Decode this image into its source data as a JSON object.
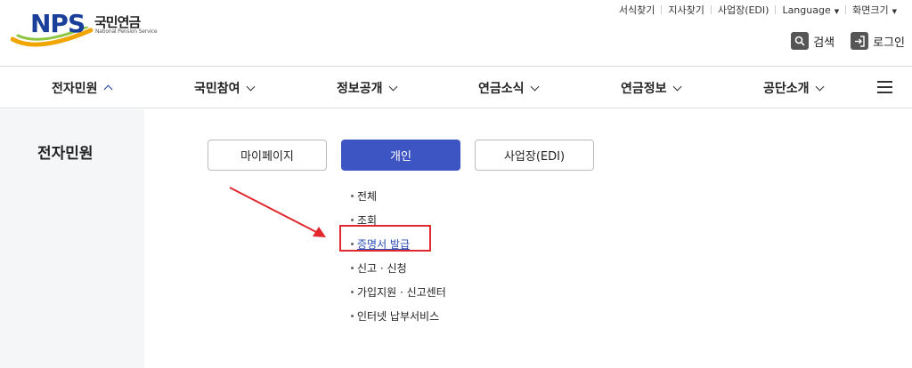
{
  "logo": {
    "nps": "NPS",
    "korean": "국민연금",
    "english": "National Pension Service"
  },
  "util_links": [
    "서식찾기",
    "지사찾기",
    "사업장(EDI)",
    "Language",
    "화면크기"
  ],
  "actions": {
    "search": "검색",
    "login": "로그인"
  },
  "gnb": [
    "전자민원",
    "국민참여",
    "정보공개",
    "연금소식",
    "연금정보",
    "공단소개"
  ],
  "side_title": "전자민원",
  "tabs": [
    "마이페이지",
    "개인",
    "사업장(EDI)"
  ],
  "active_tab": "개인",
  "sub_menu": [
    "전체",
    "조회",
    "증명서 발급",
    "신고 · 신청",
    "가입지원 · 신고센터",
    "인터넷 납부서비스"
  ],
  "highlighted_item": "증명서 발급",
  "colors": {
    "brand": "#1a3f9a",
    "active_tab": "#3d55c3",
    "highlight": "#e0282e",
    "link": "#2b4fb5"
  }
}
